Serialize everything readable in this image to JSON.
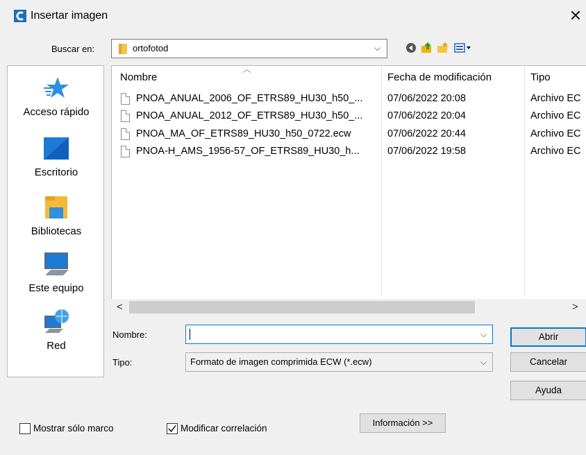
{
  "window": {
    "title": "Insertar imagen",
    "close_glyph": "✕",
    "app_icon": "app-logo-icon"
  },
  "lookin": {
    "label": "Buscar en:",
    "value": "ortofotod",
    "arrow": "⌵"
  },
  "toolbar": {
    "icons": [
      "back-icon",
      "up-folder-icon",
      "new-folder-icon",
      "view-menu-icon"
    ]
  },
  "places": [
    {
      "label": "Acceso rápido",
      "icon": "quick-access-star-icon"
    },
    {
      "label": "Escritorio",
      "icon": "desktop-icon"
    },
    {
      "label": "Bibliotecas",
      "icon": "libraries-icon"
    },
    {
      "label": "Este equipo",
      "icon": "this-pc-icon"
    },
    {
      "label": "Red",
      "icon": "network-icon"
    }
  ],
  "filelist": {
    "columns": [
      "Nombre",
      "Fecha de modificación",
      "Tipo"
    ],
    "sort_glyph": "︿",
    "rows": [
      {
        "name": "PNOA_ANUAL_2006_OF_ETRS89_HU30_h50_...",
        "date": "07/06/2022 20:08",
        "type": "Archivo EC"
      },
      {
        "name": "PNOA_ANUAL_2012_OF_ETRS89_HU30_h50_...",
        "date": "07/06/2022 20:04",
        "type": "Archivo EC"
      },
      {
        "name": "PNOA_MA_OF_ETRS89_HU30_h50_0722.ecw",
        "date": "07/06/2022 20:44",
        "type": "Archivo EC"
      },
      {
        "name": "PNOA-H_AMS_1956-57_OF_ETRS89_HU30_h...",
        "date": "07/06/2022 19:58",
        "type": "Archivo EC"
      }
    ],
    "scroll_left": "<",
    "scroll_right": ">"
  },
  "form": {
    "name_label": "Nombre:",
    "name_value": "",
    "type_label": "Tipo:",
    "type_value": "Formato de imagen comprimida ECW (*.ecw)",
    "arrow": "⌵"
  },
  "buttons": {
    "open": "Abrir",
    "cancel": "Cancelar",
    "help": "Ayuda",
    "info": "Información >>"
  },
  "options": {
    "frame_only_label": "Mostrar sólo marco",
    "frame_only_checked": false,
    "modify_correlation_label": "Modificar correlación",
    "modify_correlation_checked": true
  }
}
